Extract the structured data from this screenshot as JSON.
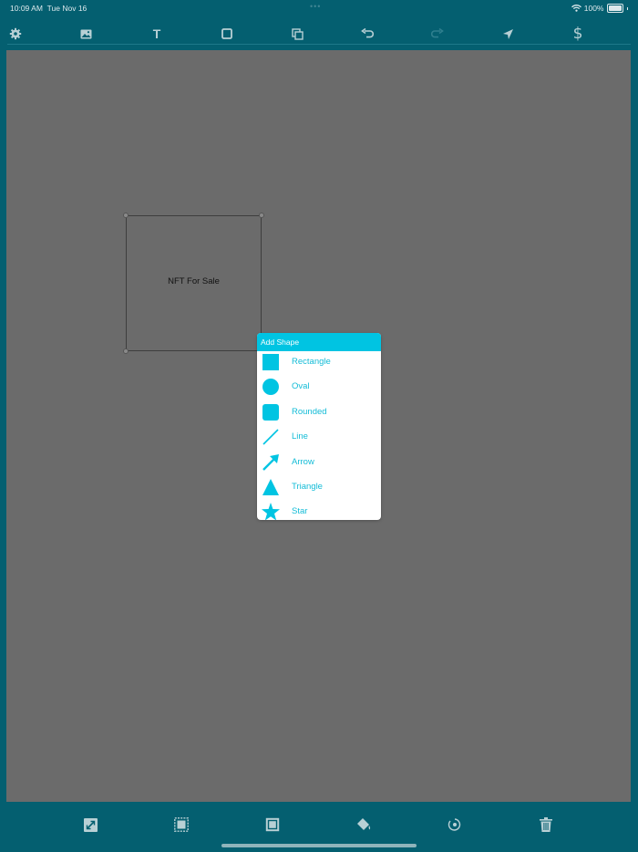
{
  "status_bar": {
    "time": "10:09 AM",
    "date": "Tue Nov 16",
    "battery_percent": "100%",
    "battery_level": 1.0,
    "multitask_dots": "•••"
  },
  "toolbar": {
    "icons": [
      "gear-icon",
      "image-icon",
      "text-icon",
      "shape-icon",
      "duplicate-icon",
      "undo-icon",
      "redo-icon",
      "send-icon",
      "dollar-icon"
    ],
    "text_glyph": "T",
    "dollar_glyph": "$"
  },
  "canvas": {
    "shape_text": "NFT For Sale"
  },
  "add_shape_menu": {
    "title": "Add Shape",
    "items": [
      {
        "label": "Rectangle",
        "icon": "rectangle-icon"
      },
      {
        "label": "Oval",
        "icon": "oval-icon"
      },
      {
        "label": "Rounded",
        "icon": "rounded-rect-icon"
      },
      {
        "label": "Line",
        "icon": "line-icon"
      },
      {
        "label": "Arrow",
        "icon": "arrow-icon"
      },
      {
        "label": "Triangle",
        "icon": "triangle-icon"
      },
      {
        "label": "Star",
        "icon": "star-icon"
      }
    ]
  },
  "bottom_toolbar": {
    "icons": [
      "resize-icon",
      "bring-forward-icon",
      "send-backward-icon",
      "fill-color-icon",
      "rotate-icon",
      "trash-icon"
    ]
  },
  "colors": {
    "chrome": "#045f70",
    "canvas": "#6b6b6b",
    "accent": "#00c4e2",
    "icon": "#b8d0d5"
  }
}
